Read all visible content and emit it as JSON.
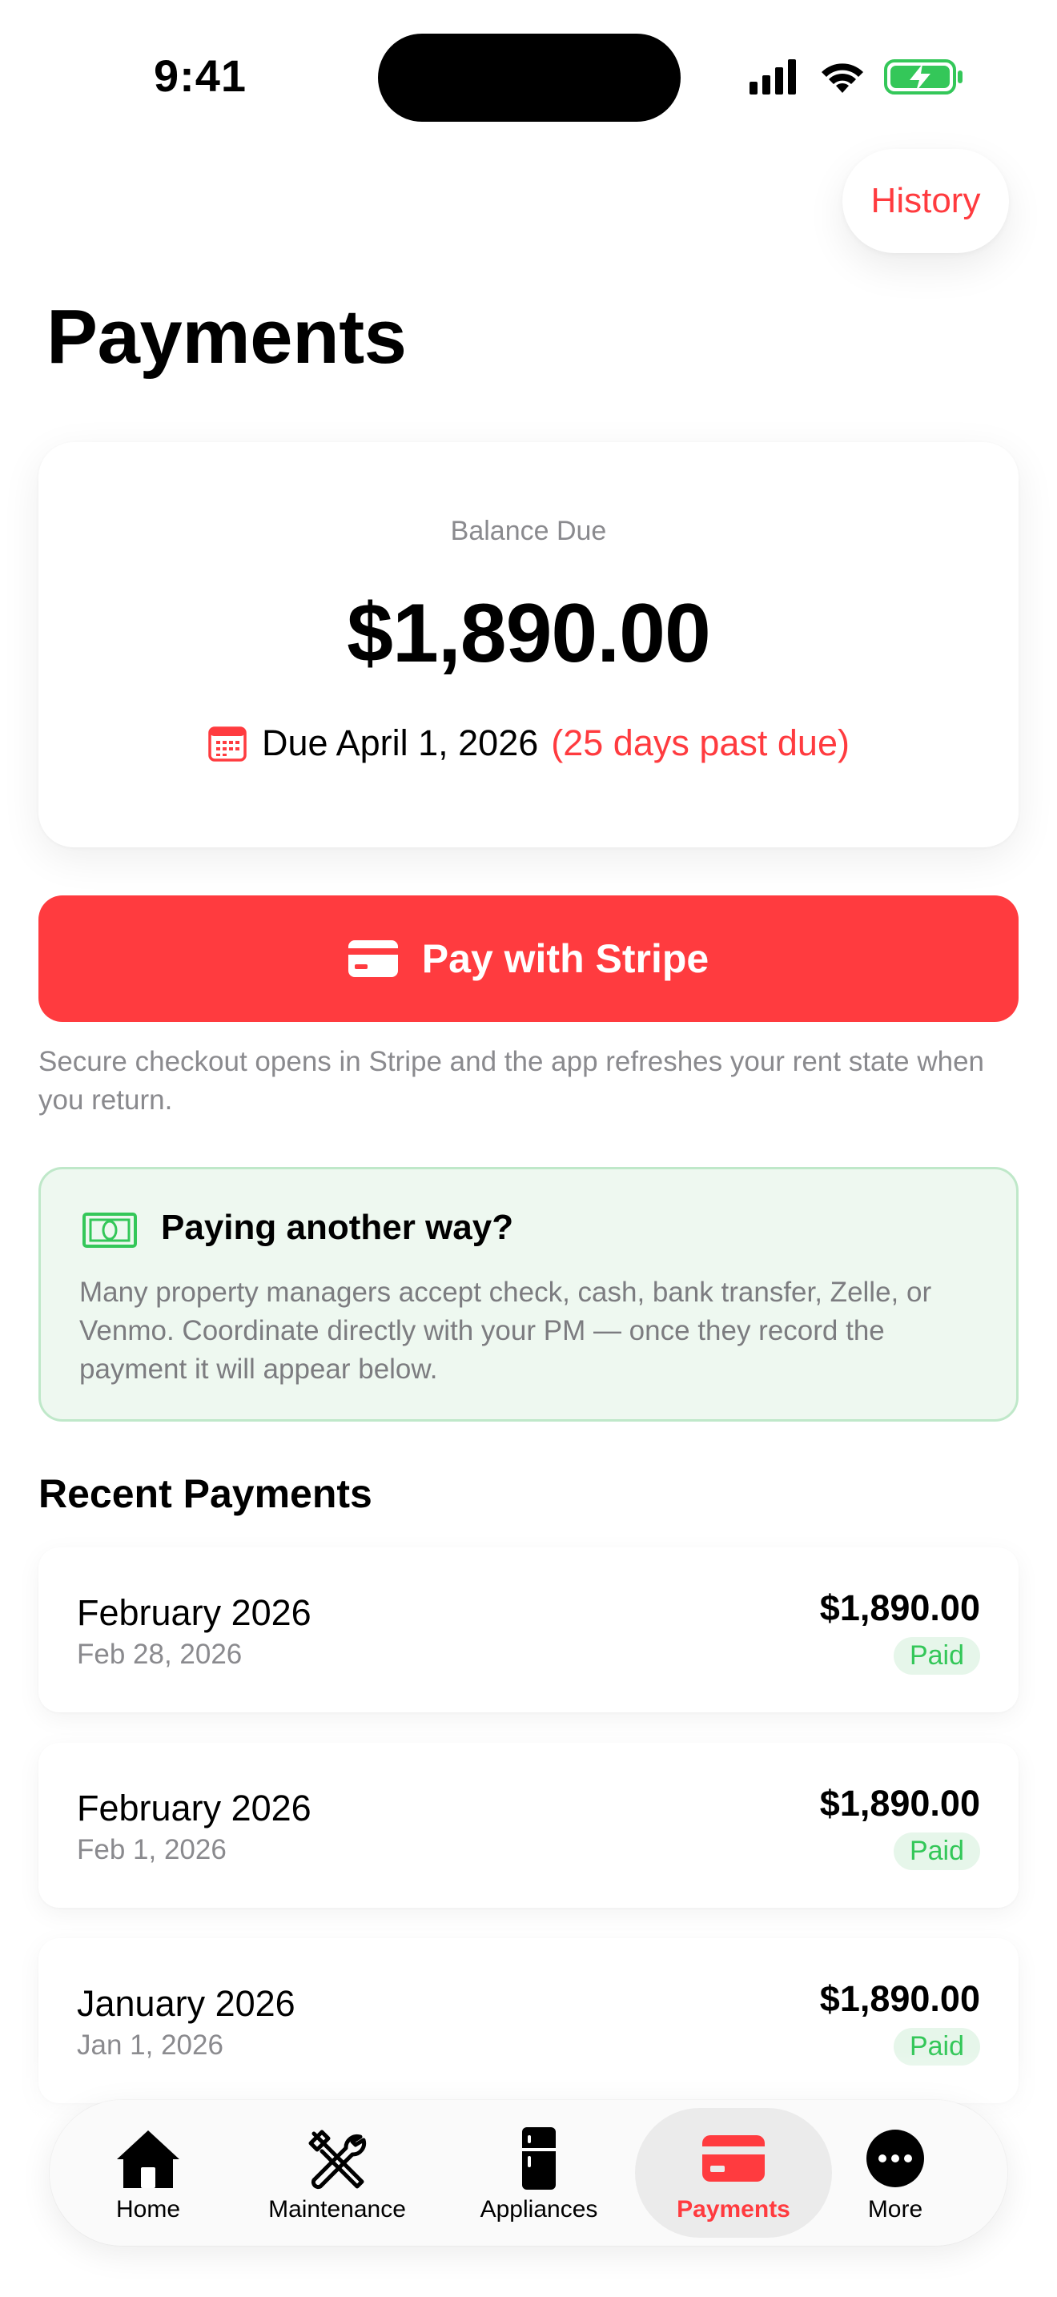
{
  "status_bar": {
    "time": "9:41",
    "icons": [
      "signal-icon",
      "wifi-icon",
      "battery-charging-icon"
    ]
  },
  "header": {
    "history_label": "History",
    "title": "Payments"
  },
  "balance": {
    "label": "Balance Due",
    "amount": "$1,890.00",
    "due_text": "Due April 1, 2026",
    "past_due_text": "(25 days past due)"
  },
  "pay_button": {
    "label": "Pay with Stripe"
  },
  "secure_note": "Secure checkout opens in Stripe and the app refreshes your rent state when you return.",
  "alt_payment": {
    "title": "Paying another way?",
    "body": "Many property managers accept check, cash, bank transfer, Zelle, or Venmo. Coordinate directly with your PM — once they record the payment it will appear below."
  },
  "recent": {
    "title": "Recent Payments",
    "items": [
      {
        "month": "February 2026",
        "date": "Feb 28, 2026",
        "amount": "$1,890.00",
        "status": "Paid"
      },
      {
        "month": "February 2026",
        "date": "Feb 1, 2026",
        "amount": "$1,890.00",
        "status": "Paid"
      },
      {
        "month": "January 2026",
        "date": "Jan 1, 2026",
        "amount": "$1,890.00",
        "status": "Paid"
      }
    ]
  },
  "tabs": [
    {
      "label": "Home",
      "icon": "house-icon",
      "active": false
    },
    {
      "label": "Maintenance",
      "icon": "tools-icon",
      "active": false
    },
    {
      "label": "Appliances",
      "icon": "fridge-icon",
      "active": false
    },
    {
      "label": "Payments",
      "icon": "credit-card-icon",
      "active": true
    },
    {
      "label": "More",
      "icon": "ellipsis-icon",
      "active": false
    }
  ],
  "colors": {
    "accent": "#ff3b3f",
    "paid_green": "#34c759",
    "alt_card_bg": "#eef8f0"
  }
}
